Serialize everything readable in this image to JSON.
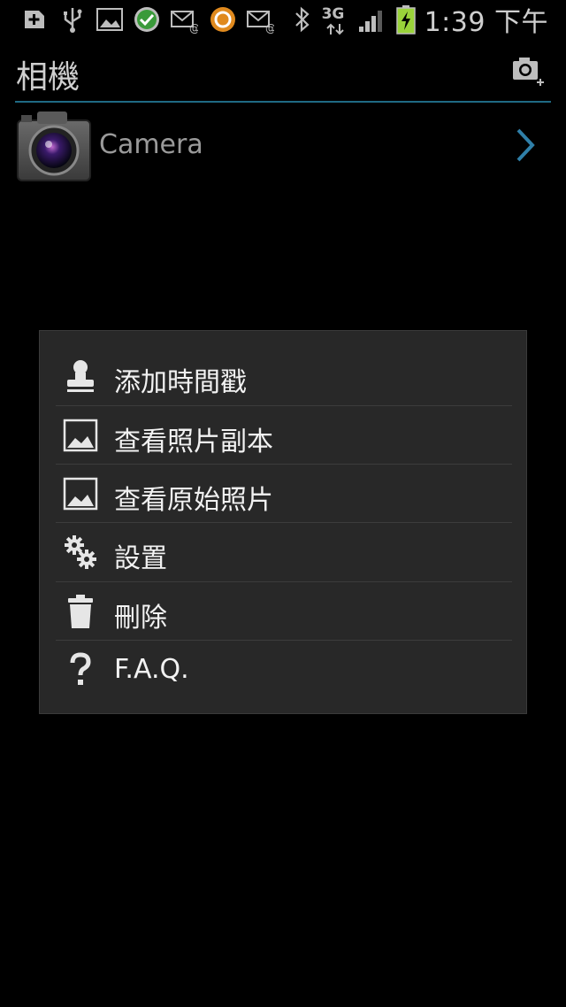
{
  "status_bar": {
    "network": "3G",
    "time": "1:39 下午"
  },
  "header": {
    "title": "相機"
  },
  "list": {
    "items": [
      {
        "label": "Camera"
      }
    ]
  },
  "menu": {
    "items": [
      {
        "label": "添加時間戳",
        "icon": "stamp-icon"
      },
      {
        "label": "查看照片副本",
        "icon": "image-icon"
      },
      {
        "label": "查看原始照片",
        "icon": "image-icon"
      },
      {
        "label": "設置",
        "icon": "gears-icon"
      },
      {
        "label": "刪除",
        "icon": "trash-icon"
      },
      {
        "label": "F.A.Q.",
        "icon": "question-icon"
      }
    ]
  },
  "colors": {
    "accent": "#1f6a84",
    "dialog_bg": "#282828"
  }
}
